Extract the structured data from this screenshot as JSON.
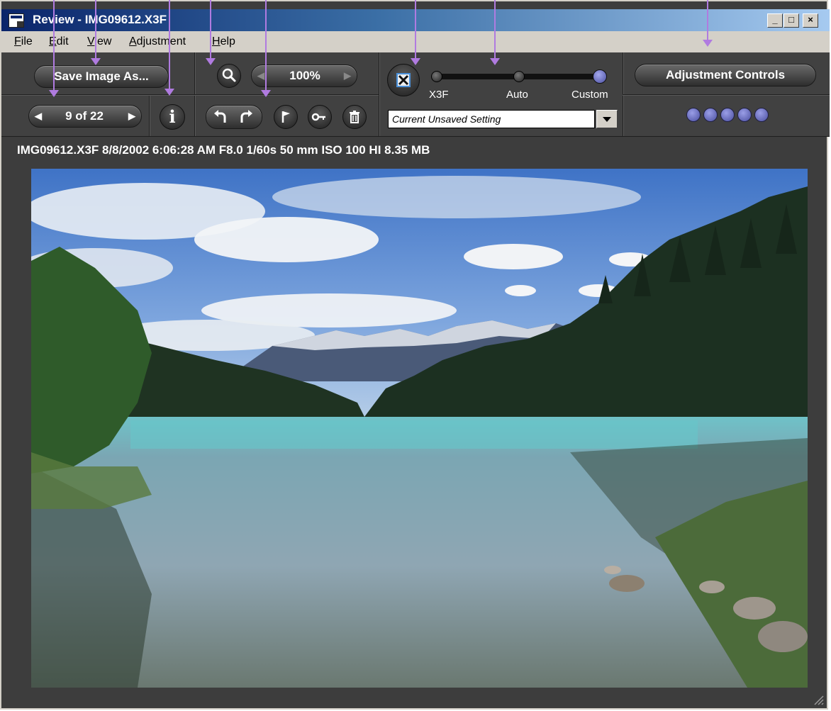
{
  "window": {
    "title": "Review - IMG09612.X3F",
    "controls": {
      "minimize": "_",
      "maximize": "□",
      "close": "×"
    }
  },
  "menu": [
    {
      "mnemonic": "F",
      "rest": "ile"
    },
    {
      "mnemonic": "E",
      "rest": "dit"
    },
    {
      "mnemonic": "V",
      "rest": "iew"
    },
    {
      "mnemonic": "A",
      "rest": "djustment"
    },
    {
      "mnemonic": "H",
      "rest": "elp"
    }
  ],
  "toolbar": {
    "save_label": "Save Image As...",
    "nav_counter": "9 of 22",
    "zoom_value": "100%",
    "adjust_label": "Adjustment Controls",
    "slider_labels": [
      "X3F",
      "Auto",
      "Custom"
    ],
    "slider_selected": "Custom",
    "setting_value": "Current Unsaved Setting",
    "dots_count": 5
  },
  "info_line": "IMG09612.X3F  8/8/2002  6:06:28 AM  F8.0  1/60s  50 mm  ISO 100  HI  8.35 MB",
  "icons": [
    "app-icon",
    "chevron-left-icon",
    "chevron-right-icon",
    "info-icon",
    "magnifier-icon",
    "rotate-left-icon",
    "rotate-right-icon",
    "flag-icon",
    "key-icon",
    "trash-icon",
    "x3f-logo-icon",
    "dropdown-arrow-icon",
    "resize-grip-icon"
  ],
  "colors": {
    "panel_bg": "#414141",
    "accent_dots": "#6a6ecf",
    "title_bar": "#0a246a"
  }
}
